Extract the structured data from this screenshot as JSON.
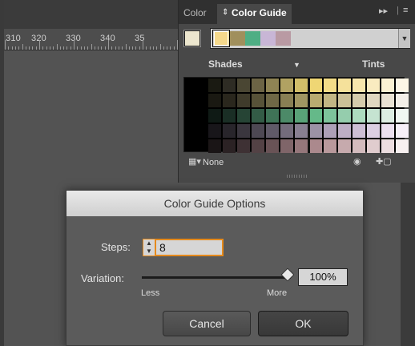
{
  "workspace": {
    "ruler_labels": [
      "310",
      "320",
      "330",
      "340",
      "35"
    ]
  },
  "color_guide_panel": {
    "tabs": [
      {
        "label": "Color"
      },
      {
        "label": "Color Guide"
      }
    ],
    "tab_menu_glyph": "▸▸",
    "panel_menu_glyph": "≡",
    "harmony_swatches": [
      "#f5d98c",
      "#a08f5c",
      "#4fae84",
      "#c8b6d6",
      "#b99aa3"
    ],
    "shades_label": "Shades",
    "tints_label": "Tints",
    "none_label": "None",
    "grid_rows": [
      [
        "#1a1a12",
        "#2e2c24",
        "#4a4633",
        "#6c6445",
        "#8f8454",
        "#b1a262",
        "#d1be6a",
        "#efd674",
        "#f3dc88",
        "#f5e19b",
        "#f7e6ad",
        "#f9ebc0",
        "#fbf1d3",
        "#fdf6e6"
      ],
      [
        "#1a1912",
        "#2a271d",
        "#3f3b2b",
        "#575238",
        "#6f6846",
        "#887f54",
        "#a09562",
        "#b9ab70",
        "#c2b684",
        "#ccc198",
        "#d5ccac",
        "#dfd7c0",
        "#e9e2d4",
        "#f3eee8"
      ],
      [
        "#0f1a15",
        "#1a2e25",
        "#264435",
        "#335b46",
        "#3f7357",
        "#4c8a68",
        "#59a278",
        "#65b989",
        "#7dc39b",
        "#95cdad",
        "#addbbf",
        "#c5e3d1",
        "#ddede3",
        "#f0f7f2"
      ],
      [
        "#18161a",
        "#28252b",
        "#3a363e",
        "#4d4853",
        "#605a68",
        "#746c7c",
        "#887f91",
        "#9c92a6",
        "#ad9fb7",
        "#bdaec5",
        "#cdbed4",
        "#dccfe2",
        "#ece0f0",
        "#f6eff8"
      ],
      [
        "#1a1516",
        "#2b2224",
        "#3e3134",
        "#534245",
        "#695356",
        "#7f6569",
        "#95777b",
        "#ab898d",
        "#b9999c",
        "#c6aaad",
        "#d3bbbd",
        "#e0ccce",
        "#ecdee0",
        "#f7f0f0"
      ]
    ]
  },
  "dialog": {
    "title": "Color Guide Options",
    "steps_label": "Steps:",
    "steps_value": "8",
    "variation_label": "Variation:",
    "variation_value": "100%",
    "variation_level": 1.0,
    "less_label": "Less",
    "more_label": "More",
    "cancel_label": "Cancel",
    "ok_label": "OK"
  }
}
